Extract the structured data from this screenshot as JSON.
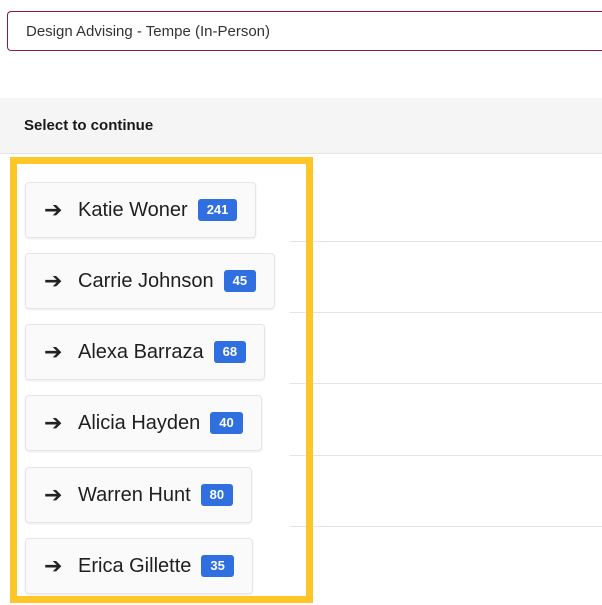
{
  "select": {
    "value": "Design Advising - Tempe (In-Person)"
  },
  "panel": {
    "heading": "Select to continue"
  },
  "advisors": [
    {
      "name": "Katie Woner",
      "count": "241"
    },
    {
      "name": "Carrie Johnson",
      "count": "45"
    },
    {
      "name": "Alexa Barraza",
      "count": "68"
    },
    {
      "name": "Alicia Hayden",
      "count": "40"
    },
    {
      "name": "Warren Hunt",
      "count": "80"
    },
    {
      "name": "Erica Gillette",
      "count": "35"
    }
  ],
  "icons": {
    "row_arrow": "arrow-right-icon"
  },
  "colors": {
    "highlight": "#ffc627",
    "badge": "#2f6fe0",
    "field_border": "#8c1d40"
  }
}
